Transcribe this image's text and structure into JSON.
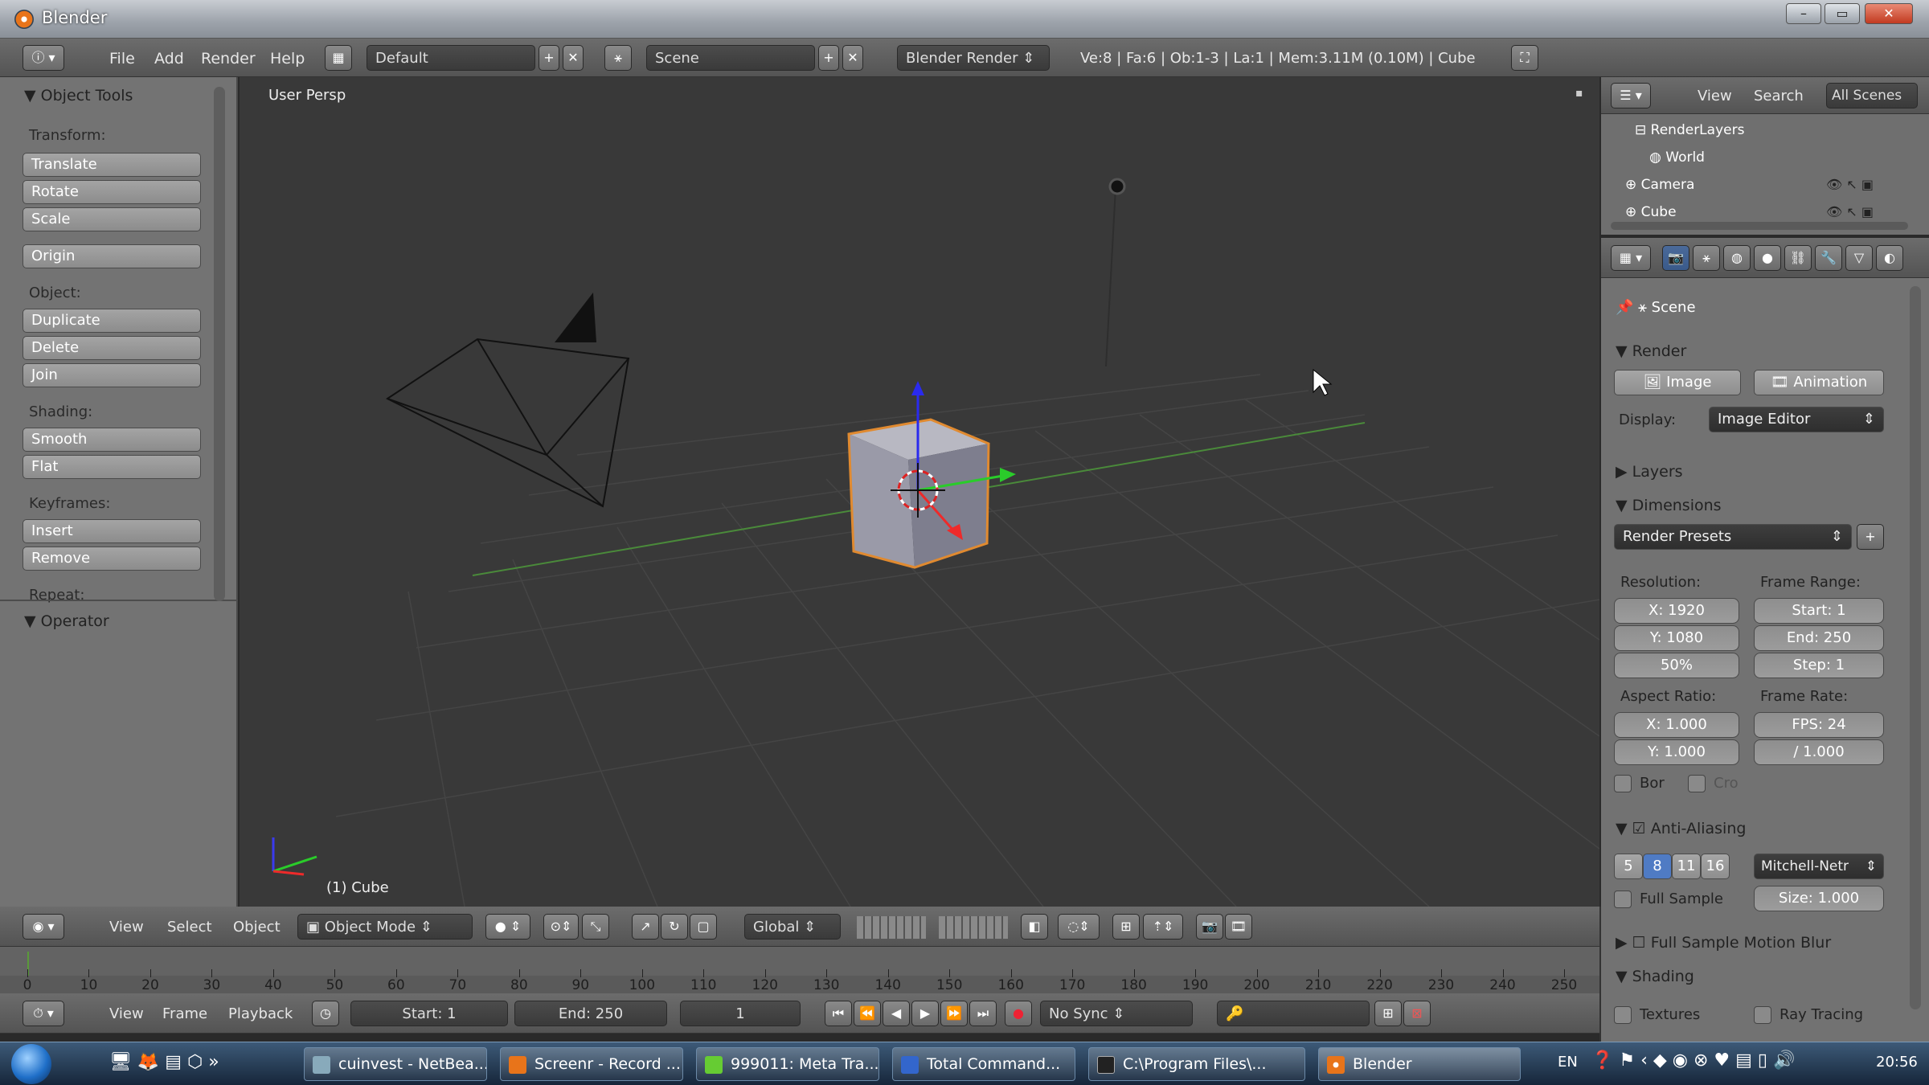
{
  "window": {
    "title": "Blender"
  },
  "info": {
    "menus": [
      "File",
      "Add",
      "Render",
      "Help"
    ],
    "layout": "Default",
    "scene": "Scene",
    "engine": "Blender Render",
    "stats": "Ve:8 | Fa:6 | Ob:1-3 | La:1 | Mem:3.11M (0.10M) | Cube"
  },
  "tools": {
    "header": "Object Tools",
    "transform_label": "Transform:",
    "translate": "Translate",
    "rotate": "Rotate",
    "scale": "Scale",
    "origin": "Origin",
    "object_label": "Object:",
    "duplicate": "Duplicate",
    "delete": "Delete",
    "join": "Join",
    "shading_label": "Shading:",
    "smooth": "Smooth",
    "flat": "Flat",
    "keyframes_label": "Keyframes:",
    "insert": "Insert",
    "remove": "Remove",
    "repeat_label": "Repeat:",
    "operator": "Operator"
  },
  "viewport": {
    "label": "User Persp",
    "object_label": "(1) Cube"
  },
  "outliner": {
    "view": "View",
    "search": "Search",
    "filter": "All Scenes",
    "items": [
      "RenderLayers",
      "World",
      "Camera",
      "Cube"
    ]
  },
  "props": {
    "scene": "Scene",
    "render": "Render",
    "image": "Image",
    "animation": "Animation",
    "display_label": "Display:",
    "display_value": "Image Editor",
    "layers": "Layers",
    "dimensions": "Dimensions",
    "presets": "Render Presets",
    "resolution_label": "Resolution:",
    "res_x": "X: 1920",
    "res_y": "Y: 1080",
    "res_pct": "50%",
    "frame_range_label": "Frame Range:",
    "start": "Start: 1",
    "end": "End: 250",
    "step": "Step: 1",
    "aspect_label": "Aspect Ratio:",
    "asp_x": "X: 1.000",
    "asp_y": "Y: 1.000",
    "frame_rate_label": "Frame Rate:",
    "fps": "FPS: 24",
    "fps_base": "/ 1.000",
    "bor": "Bor",
    "crop": "Cro",
    "anti_aliasing": "Anti-Aliasing",
    "aa_levels": [
      "5",
      "8",
      "11",
      "16"
    ],
    "filter": "Mitchell-Netr",
    "full_sample": "Full Sample",
    "size": "Size: 1.000",
    "motion_blur": "Full Sample Motion Blur",
    "shading": "Shading",
    "textures": "Textures",
    "ray_tracing": "Ray Tracing"
  },
  "vpheader": {
    "view": "View",
    "select": "Select",
    "object": "Object",
    "mode": "Object Mode",
    "orientation": "Global"
  },
  "timeline": {
    "ticks": [
      "0",
      "10",
      "20",
      "30",
      "40",
      "50",
      "60",
      "70",
      "80",
      "90",
      "100",
      "110",
      "120",
      "130",
      "140",
      "150",
      "160",
      "170",
      "180",
      "190",
      "200",
      "210",
      "220",
      "230",
      "240",
      "250"
    ],
    "view": "View",
    "frame": "Frame",
    "playback": "Playback",
    "start": "Start: 1",
    "end": "End: 250",
    "current": "1",
    "sync": "No Sync"
  },
  "taskbar": {
    "tasks": [
      "cuinvest - NetBea...",
      "Screenr - Record ...",
      "999011: Meta Tra...",
      "Total Command...",
      "C:\\Program Files\\...",
      "Blender"
    ],
    "lang": "EN",
    "clock": "20:56"
  }
}
